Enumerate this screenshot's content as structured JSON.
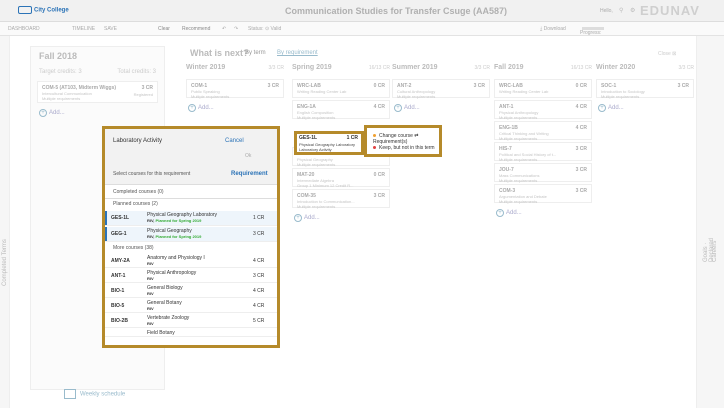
{
  "header": {
    "logo_text": "City College",
    "title": "Communication Studies for Transfer Csuge (AA587)",
    "hello": "Hello,",
    "brand": "EDUNAV"
  },
  "toolbar": {
    "dashboard": "DASHBOARD",
    "timeline": "TIMELINE",
    "save": "SAVE",
    "clear": "Clear",
    "recommend": "Recommend",
    "status": "Status: ⊙ Valid",
    "download": "⤓ Download",
    "progress": "Progress:"
  },
  "left_rail_label": "Completed Terms",
  "fall": {
    "title": "Fall 2018",
    "target": "Target credits: 3",
    "total": "Total credits: 3",
    "card": {
      "code": "COM-5 (AT103, Midterm Wiggs)",
      "cr": "3 CR",
      "l1": "Intercultural Communication",
      "l2": "Multiple requirements",
      "tag": "Registered"
    },
    "add": "Add..."
  },
  "plan": {
    "what_next": "What is next?",
    "by_term": "By term",
    "by_requirement": "By requirement",
    "close_all": "Close ⊠"
  },
  "columns": [
    {
      "title": "Winter 2019",
      "credits": "3/3 CR",
      "cards": [
        {
          "code": "COM-1",
          "cr": "3 CR",
          "l1": "Public Speaking",
          "l2": "Multiple requirements"
        }
      ],
      "add": "Add..."
    },
    {
      "title": "Spring 2019",
      "credits": "16/13 CR",
      "cards": [
        {
          "code": "WRC-LAB",
          "cr": "0 CR",
          "l1": "Writing Reading Center Lab",
          "l2": ""
        },
        {
          "code": "ENG-1A",
          "cr": "4 CR",
          "l1": "English Composition",
          "l2": "Multiple requirements"
        },
        {
          "code": "GEG-1",
          "cr": "3 CR",
          "l1": "Physical Geography",
          "l2": "Multiple requirements"
        },
        {
          "code": "MAT-20",
          "cr": "0 CR",
          "l1": "Intermediate Algebra",
          "l2": "Group 1 Minimum 12 Credit R..."
        },
        {
          "code": "COM-35",
          "cr": "3 CR",
          "l1": "Introduction to Communication...",
          "l2": "Multiple requirements"
        }
      ],
      "add": "Add..."
    },
    {
      "title": "Summer 2019",
      "credits": "3/3 CR",
      "cards": [
        {
          "code": "ANT-2",
          "cr": "3 CR",
          "l1": "Cultural Anthropology",
          "l2": "Multiple requirements"
        }
      ],
      "add": "Add..."
    },
    {
      "title": "Fall 2019",
      "credits": "16/13 CR",
      "cards": [
        {
          "code": "WRC-LAB",
          "cr": "0 CR",
          "l1": "Writing Reading Center Lab",
          "l2": ""
        },
        {
          "code": "ANT-1",
          "cr": "4 CR",
          "l1": "Physical Anthropology",
          "l2": "Multiple requirements"
        },
        {
          "code": "ENG-1B",
          "cr": "4 CR",
          "l1": "Critical Thinking and Writing",
          "l2": "Multiple requirements"
        },
        {
          "code": "HIS-7",
          "cr": "3 CR",
          "l1": "Political and Social History of t...",
          "l2": "Multiple requirements"
        },
        {
          "code": "JOU-7",
          "cr": "3 CR",
          "l1": "Mass Communications",
          "l2": "Multiple requirements"
        },
        {
          "code": "COM-3",
          "cr": "3 CR",
          "l1": "Argumentation and Debate",
          "l2": "Multiple requirements"
        }
      ],
      "add": "Add..."
    },
    {
      "title": "Winter 2020",
      "credits": "3/3 CR",
      "cards": [
        {
          "code": "SOC-1",
          "cr": "3 CR",
          "l1": "Introduction to Sociology",
          "l2": "Multiple requirements"
        }
      ],
      "add": "Add..."
    }
  ],
  "right_rail": {
    "goals": "Goals · Declared",
    "careers": "Careers"
  },
  "weekly": "Weekly schedule",
  "ges_card": {
    "code": "GES-1L",
    "cr": "1 CR",
    "l1": "Physical Geography Laboratory",
    "l2": "Laboratory Activity"
  },
  "context_menu": {
    "change": "Change course ⇄ Requirement(s)",
    "keep": "Keep, but not in this term",
    "change_color": "#f0a030",
    "keep_color": "#e04040"
  },
  "panel": {
    "activity": "Laboratory Activity",
    "cancel": "Cancel",
    "ok": "Ok",
    "select_label": "Select courses for this requirement",
    "requirement": "Requirement",
    "completed": "Completed courses (0)",
    "planned": "Planned courses (2)",
    "planned_rows": [
      {
        "code": "GES-1L",
        "name": "Physical Geography Laboratory",
        "req": "RIV,",
        "note": "Planned for Spring 2019",
        "cr": "1 CR"
      },
      {
        "code": "GEG-1",
        "name": "Physical Geography",
        "req": "RIV,",
        "note": "Planned for Spring 2019",
        "cr": "3 CR"
      }
    ],
    "more": "More courses (38)",
    "more_rows": [
      {
        "code": "AMY-2A",
        "name": "Anatomy and Physiology I",
        "req": "RIV",
        "cr": "4 CR"
      },
      {
        "code": "ANT-1",
        "name": "Physical Anthropology",
        "req": "RIV",
        "cr": "3 CR"
      },
      {
        "code": "BIO-1",
        "name": "General Biology",
        "req": "RIV",
        "cr": "4 CR"
      },
      {
        "code": "BIO-5",
        "name": "General Botany",
        "req": "RIV",
        "cr": "4 CR"
      },
      {
        "code": "BIO-2B",
        "name": "Vertebrate Zoology",
        "req": "RIV",
        "cr": "5 CR"
      },
      {
        "code": "",
        "name": "Field Botany",
        "req": "",
        "cr": ""
      }
    ]
  },
  "colors": {
    "highlight_border": "#b58a2a",
    "link": "#2b73b7",
    "planned_green": "#33aa33"
  }
}
